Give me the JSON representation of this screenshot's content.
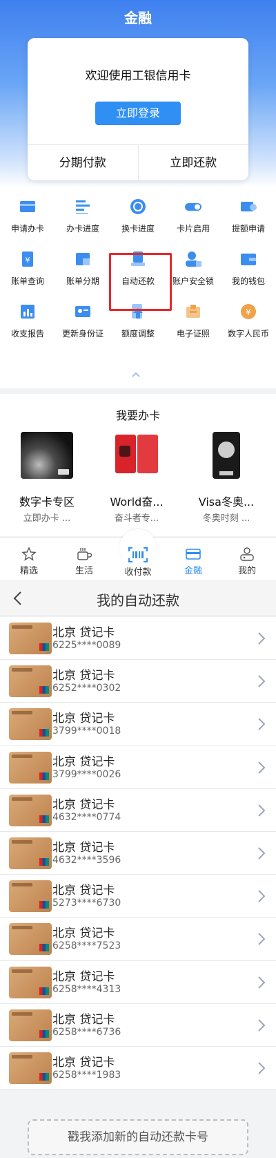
{
  "finance": {
    "title": "金融",
    "welcome": "欢迎使用工银信用卡",
    "login_label": "立即登录",
    "installment_label": "分期付款",
    "repay_label": "立即还款",
    "grid": [
      {
        "label": "申请办卡",
        "icon": "card-apply-icon",
        "color": "#3b8ef0"
      },
      {
        "label": "办卡进度",
        "icon": "progress-list-icon",
        "color": "#3b8ef0"
      },
      {
        "label": "换卡进度",
        "icon": "exchange-icon",
        "color": "#3b8ef0"
      },
      {
        "label": "卡片启用",
        "icon": "toggle-icon",
        "color": "#3b8ef0"
      },
      {
        "label": "提额申请",
        "icon": "upgrade-icon",
        "color": "#3b8ef0"
      },
      {
        "label": "账单查询",
        "icon": "bill-query-icon",
        "color": "#3b8ef0"
      },
      {
        "label": "账单分期",
        "icon": "bill-installment-icon",
        "color": "#3b8ef0"
      },
      {
        "label": "自动还款",
        "icon": "auto-repay-icon",
        "color": "#3b8ef0"
      },
      {
        "label": "账户安全锁",
        "icon": "account-lock-icon",
        "color": "#3b8ef0"
      },
      {
        "label": "我的钱包",
        "icon": "wallet-icon",
        "color": "#3b8ef0"
      },
      {
        "label": "收支报告",
        "icon": "report-icon",
        "color": "#3b8ef0"
      },
      {
        "label": "更新身份证",
        "icon": "id-card-icon",
        "color": "#3b8ef0"
      },
      {
        "label": "额度调整",
        "icon": "limit-adjust-icon",
        "color": "#3b8ef0"
      },
      {
        "label": "电子证照",
        "icon": "e-license-icon",
        "color": "#f0a24a"
      },
      {
        "label": "数字人民币",
        "icon": "digital-rmb-icon",
        "color": "#f0a24a"
      }
    ],
    "apply_title": "我要办卡",
    "promos": [
      {
        "name": "数字卡专区",
        "sub": "立即办卡 ..."
      },
      {
        "name": "World奋...",
        "sub": "奋斗者专..."
      },
      {
        "name": "Visa冬奥...",
        "sub": "冬奥时刻 ..."
      }
    ],
    "tabs": [
      {
        "label": "精选",
        "icon": "star-icon"
      },
      {
        "label": "生活",
        "icon": "cup-icon"
      },
      {
        "label": "收付款",
        "icon": "scan-icon"
      },
      {
        "label": "金融",
        "icon": "card-icon"
      },
      {
        "label": "我的",
        "icon": "user-icon"
      }
    ]
  },
  "auto_repay": {
    "title": "我的自动还款",
    "cards": [
      {
        "name": "北京 贷记卡",
        "number": "6225****0089"
      },
      {
        "name": "北京 贷记卡",
        "number": "6252****0302"
      },
      {
        "name": "北京 贷记卡",
        "number": "3799****0018"
      },
      {
        "name": "北京 贷记卡",
        "number": "3799****0026"
      },
      {
        "name": "北京 贷记卡",
        "number": "4632****0774"
      },
      {
        "name": "北京 贷记卡",
        "number": "4632****3596"
      },
      {
        "name": "北京 贷记卡",
        "number": "5273****6730"
      },
      {
        "name": "北京 贷记卡",
        "number": "6258****7523"
      },
      {
        "name": "北京 贷记卡",
        "number": "6258****4313"
      },
      {
        "name": "北京 贷记卡",
        "number": "6258****6736"
      },
      {
        "name": "北京 贷记卡",
        "number": "6258****1983"
      }
    ],
    "add_label": "戳我添加新的自动还款卡号"
  },
  "colors": {
    "accent": "#2f8ff2",
    "highlight": "#e5282b",
    "card_gold": "#c9925e"
  }
}
